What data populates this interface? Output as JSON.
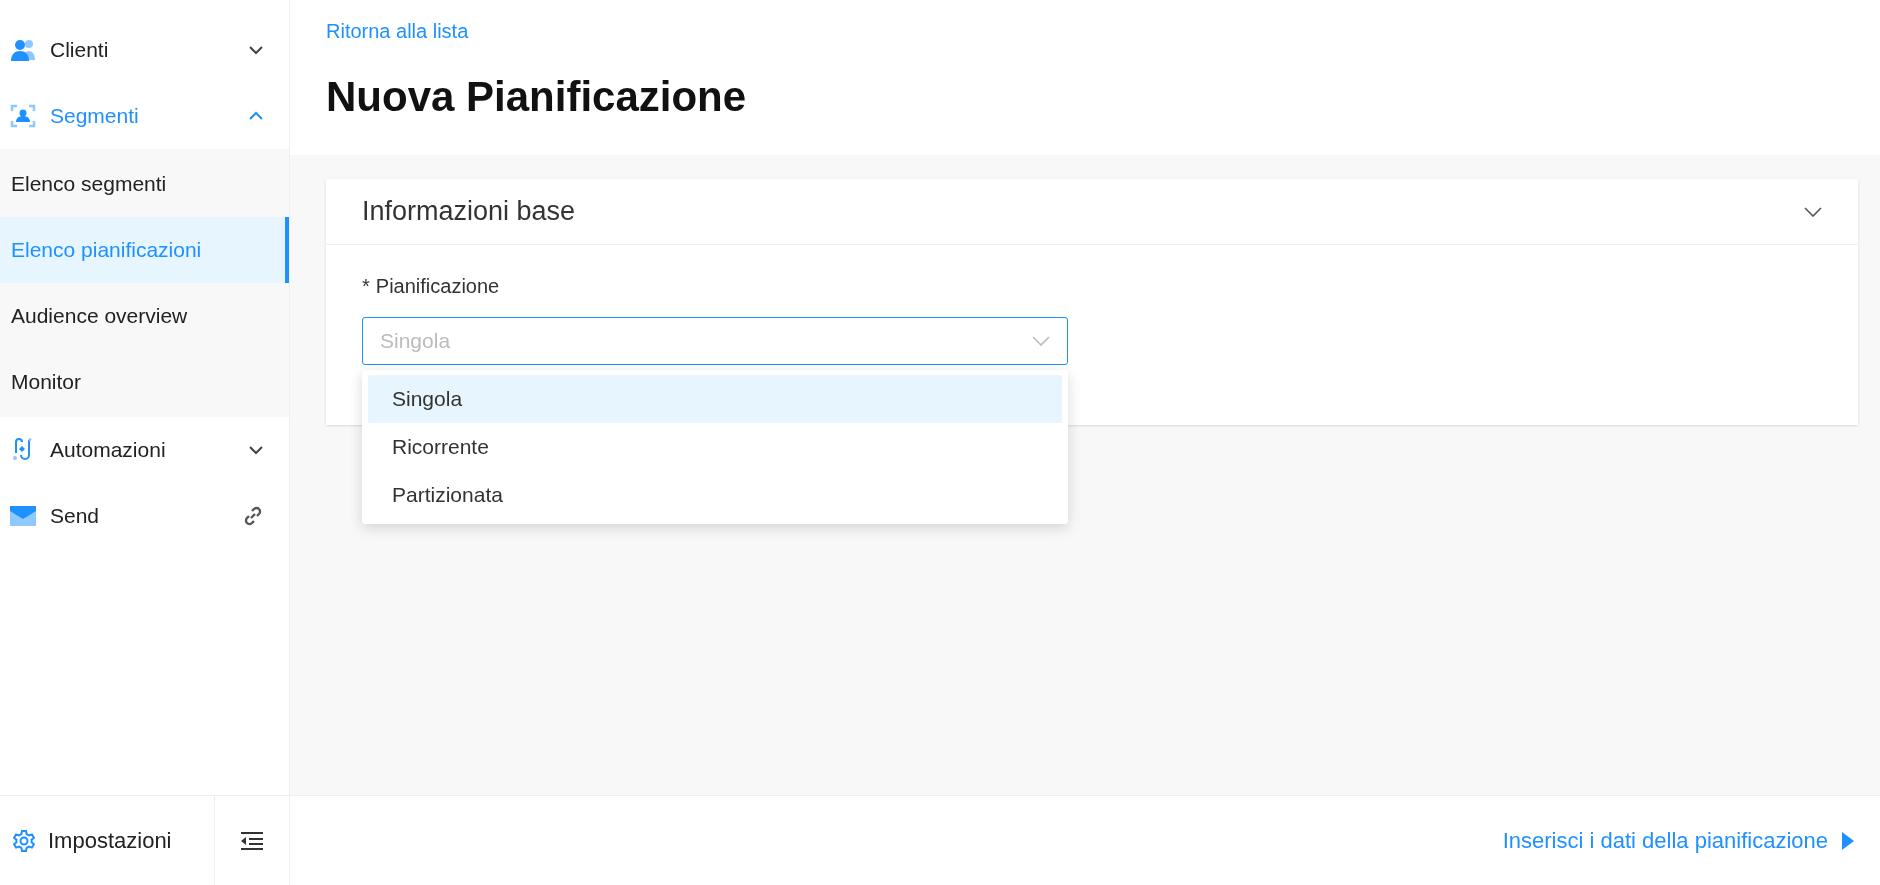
{
  "sidebar": {
    "items": [
      {
        "label": "Clienti",
        "expanded": false
      },
      {
        "label": "Segmenti",
        "expanded": true,
        "children": [
          {
            "label": "Elenco segmenti",
            "selected": false
          },
          {
            "label": "Elenco pianificazioni",
            "selected": true
          },
          {
            "label": "Audience overview",
            "selected": false
          },
          {
            "label": "Monitor",
            "selected": false
          }
        ]
      },
      {
        "label": "Automazioni",
        "expanded": false
      },
      {
        "label": "Send"
      }
    ],
    "settings": "Impostazioni"
  },
  "back_link": "Ritorna alla lista",
  "page_title": "Nuova Pianificazione",
  "card": {
    "title": "Informazioni base",
    "expanded": true,
    "field": {
      "required_mark": "*",
      "label": "Pianificazione",
      "placeholder": "Singola",
      "options": [
        {
          "label": "Singola",
          "selected": true
        },
        {
          "label": "Ricorrente",
          "selected": false
        },
        {
          "label": "Partizionata",
          "selected": false
        }
      ]
    }
  },
  "footer": {
    "next_link": "Inserisci i dati della pianificazione"
  }
}
